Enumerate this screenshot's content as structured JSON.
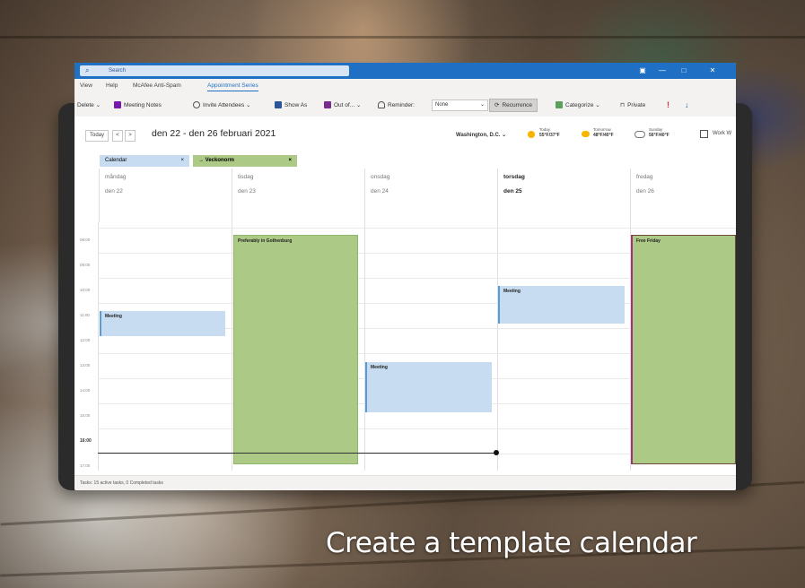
{
  "titlebar": {
    "search_placeholder": "Search",
    "window_buttons": [
      "—",
      "□",
      "✕"
    ]
  },
  "menu": [
    "View",
    "Help",
    "McAfee Anti-Spam",
    "Appointment Series"
  ],
  "ribbon": {
    "delete": "Delete ⌄",
    "meeting_notes": "Meeting Notes",
    "invite_attendees": "Invite Attendees ⌄",
    "show_as": "Show As",
    "out_of": "Out of... ⌄",
    "reminder": "Reminder:",
    "reminder_value": "None",
    "recurrence": "Recurrence",
    "categorize": "Categorize ⌄",
    "private": "Private",
    "importance_high": "!",
    "importance_low": "↓"
  },
  "nav": {
    "today": "Today",
    "prev": "<",
    "next": ">",
    "date_range": "den 22 - den 26 februari 2021",
    "location": "Washington, D.C. ⌄",
    "weather": [
      {
        "day": "Today",
        "temp": "55°F/37°F"
      },
      {
        "day": "Tomorrow",
        "temp": "48°F/40°F"
      },
      {
        "day": "Sunday",
        "temp": "56°F/40°F"
      }
    ],
    "work_week": "Work W"
  },
  "calendar_tabs": [
    {
      "label": "Calendar",
      "close": "×"
    },
    {
      "label": "Veckonorm",
      "close": "×"
    }
  ],
  "days": [
    {
      "name": "måndag",
      "date": "den 22"
    },
    {
      "name": "tisdag",
      "date": "den 23"
    },
    {
      "name": "onsdag",
      "date": "den 24"
    },
    {
      "name": "torsdag",
      "date": "den 25"
    },
    {
      "name": "fredag",
      "date": "den 26"
    }
  ],
  "times": [
    "08:00",
    "09:00",
    "10:00",
    "11:00",
    "12:00",
    "13:00",
    "14:00",
    "15:00",
    "16:00",
    "17:00"
  ],
  "now_label": "16:00",
  "events": [
    {
      "title": "Meeting",
      "day": "måndag"
    },
    {
      "title": "Preferably in Gothenburg",
      "day": "tisdag"
    },
    {
      "title": "Meeting",
      "day": "onsdag"
    },
    {
      "title": "Meeting",
      "day": "torsdag"
    },
    {
      "title": "Free Friday",
      "day": "fredag"
    }
  ],
  "status": "Tasks: 15 active tasks, 0 Completed tasks",
  "caption": "Create a template calendar"
}
